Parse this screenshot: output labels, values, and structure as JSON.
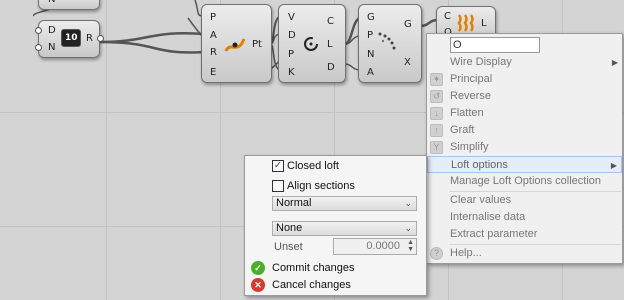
{
  "canvas": {
    "components": [
      {
        "id": "top-stub",
        "pins": [
          "N"
        ]
      },
      {
        "id": "divide",
        "inputs": [
          "D",
          "N"
        ],
        "outputs": [
          "R"
        ],
        "icon_text": "10"
      },
      {
        "id": "point-on-curve",
        "inputs": [
          "P",
          "A",
          "R",
          "E"
        ],
        "outputs": [
          "Pt"
        ]
      },
      {
        "id": "curve-info",
        "inputs": [
          "V",
          "D",
          "P",
          "K"
        ],
        "outputs": [
          "C",
          "L",
          "D"
        ]
      },
      {
        "id": "grid",
        "inputs": [
          "G",
          "P",
          "N",
          "A"
        ],
        "outputs": [
          "G",
          "X"
        ]
      },
      {
        "id": "loft",
        "inputs": [
          "C",
          "O"
        ],
        "outputs": [
          "L"
        ]
      }
    ]
  },
  "context_menu": {
    "name_value": "O",
    "items": [
      {
        "label": "Wire Display",
        "icon": "",
        "submenu": true
      },
      {
        "label": "Principal",
        "icon": "principal-icon"
      },
      {
        "label": "Reverse",
        "icon": "reverse-icon"
      },
      {
        "label": "Flatten",
        "icon": "flatten-icon"
      },
      {
        "label": "Graft",
        "icon": "graft-icon"
      },
      {
        "label": "Simplify",
        "icon": "simplify-icon"
      },
      {
        "label": "Loft options",
        "icon": "",
        "submenu": true,
        "active": true
      },
      {
        "label": "Manage Loft Options collection",
        "icon": ""
      },
      {
        "label": "Clear values",
        "icon": ""
      },
      {
        "label": "Internalise data",
        "icon": ""
      },
      {
        "label": "Extract parameter",
        "icon": ""
      },
      {
        "label": "Help...",
        "icon": "help-icon"
      }
    ]
  },
  "loft_options": {
    "closed_loft": {
      "label": "Closed loft",
      "checked": true
    },
    "align_sections": {
      "label": "Align sections",
      "checked": false
    },
    "loft_type": "Normal",
    "rebuild_mode": "None",
    "unset_label": "Unset",
    "unset_value": "0.0000",
    "commit_label": "Commit changes",
    "cancel_label": "Cancel changes",
    "commit_color": "#4caf2a",
    "cancel_color": "#d83a2a"
  }
}
